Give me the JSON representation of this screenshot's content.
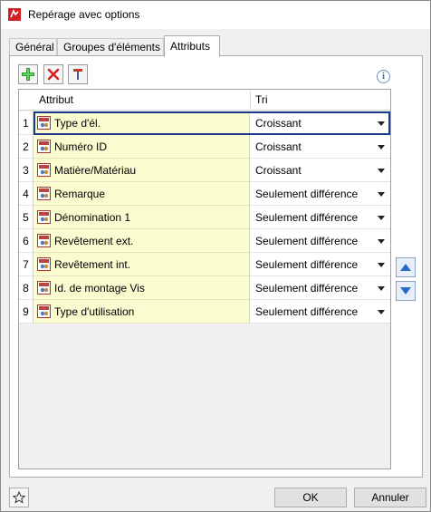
{
  "window": {
    "title": "Repérage avec options"
  },
  "tabs": [
    {
      "label": "Général",
      "active": false
    },
    {
      "label": "Groupes d'éléments",
      "active": false
    },
    {
      "label": "Attributs",
      "active": true
    }
  ],
  "toolbar": {
    "add_icon": "add-plus-icon",
    "delete_icon": "delete-x-icon",
    "attribute_icon": "attribute-pin-icon",
    "info_icon": "info-icon",
    "info_glyph": "i"
  },
  "grid": {
    "headers": {
      "attribut": "Attribut",
      "tri": "Tri"
    },
    "rows": [
      {
        "num": "1",
        "attribut": "Type d'él.",
        "tri": "Croissant",
        "selected": true
      },
      {
        "num": "2",
        "attribut": "Numéro ID",
        "tri": "Croissant"
      },
      {
        "num": "3",
        "attribut": "Matière/Matériau",
        "tri": "Croissant"
      },
      {
        "num": "4",
        "attribut": "Remarque",
        "tri": "Seulement différence"
      },
      {
        "num": "5",
        "attribut": "Dénomination 1",
        "tri": "Seulement différence"
      },
      {
        "num": "6",
        "attribut": "Revêtement ext.",
        "tri": "Seulement différence"
      },
      {
        "num": "7",
        "attribut": "Revêtement int.",
        "tri": "Seulement différence"
      },
      {
        "num": "8",
        "attribut": "Id. de montage Vis",
        "tri": "Seulement différence"
      },
      {
        "num": "9",
        "attribut": "Type d'utilisation",
        "tri": "Seulement différence"
      }
    ]
  },
  "buttons": {
    "ok": "OK",
    "cancel": "Annuler"
  },
  "colors": {
    "attr_bg": "#fbfbd0",
    "selection": "#1b3a8a",
    "accent_blue": "#2a6cc8"
  }
}
